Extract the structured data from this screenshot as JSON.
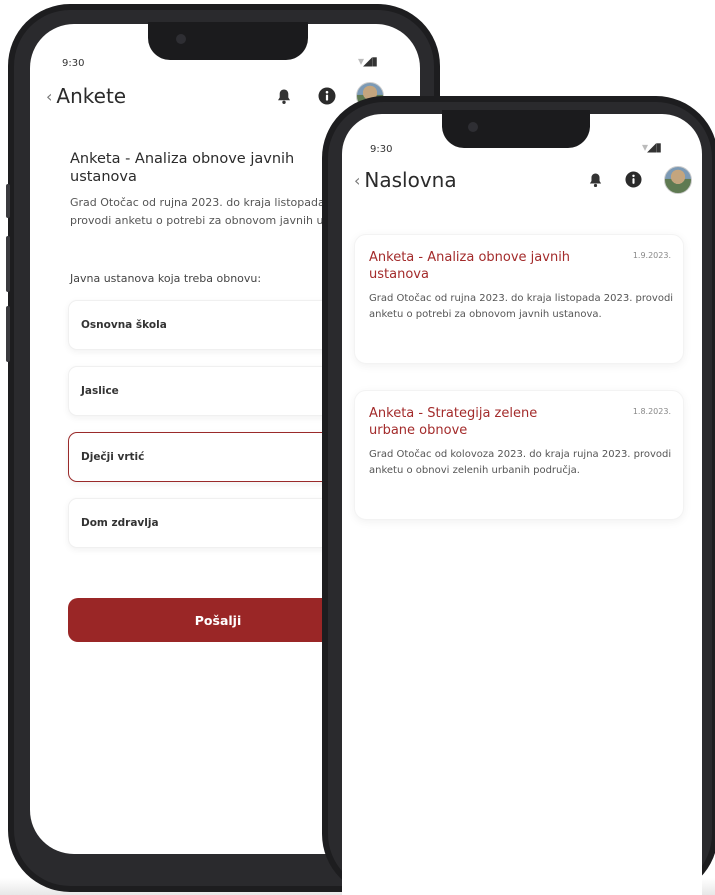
{
  "back_phone": {
    "status_time": "9:30",
    "title": "Ankete",
    "survey": {
      "title": "Anketa - Analiza obnove javnih ustanova",
      "description": "Grad Otočac od rujna 2023. do kraja listopada 2023. provodi anketu o potrebi za obnovom javnih ustanova.",
      "question": "Javna ustanova koja treba obnovu:",
      "options": [
        {
          "label": "Osnovna škola",
          "selected": false
        },
        {
          "label": "Jaslice",
          "selected": false
        },
        {
          "label": "Dječji vrtić",
          "selected": true
        },
        {
          "label": "Dom zdravlja",
          "selected": false
        }
      ],
      "submit_label": "Pošalji"
    }
  },
  "front_phone": {
    "status_time": "9:30",
    "title": "Naslovna",
    "cards": [
      {
        "title": "Anketa - Analiza obnove javnih ustanova",
        "date": "1.9.2023.",
        "description": "Grad Otočac od rujna 2023. do kraja listopada 2023. provodi anketu o potrebi za obnovom javnih ustanova."
      },
      {
        "title": "Anketa - Strategija zelene urbane obnove",
        "date": "1.8.2023.",
        "description": "Grad Otočac od kolovoza 2023. do kraja rujna 2023. provodi anketu o obnovi zelenih urbanih područja."
      }
    ]
  },
  "icons": {
    "back": "chevron-left-icon",
    "notifications": "bell-icon",
    "info": "info-icon",
    "profile": "avatar"
  },
  "colors": {
    "accent": "#9a2626",
    "card_title": "#a32b2b",
    "frame": "#1d1d1f"
  }
}
